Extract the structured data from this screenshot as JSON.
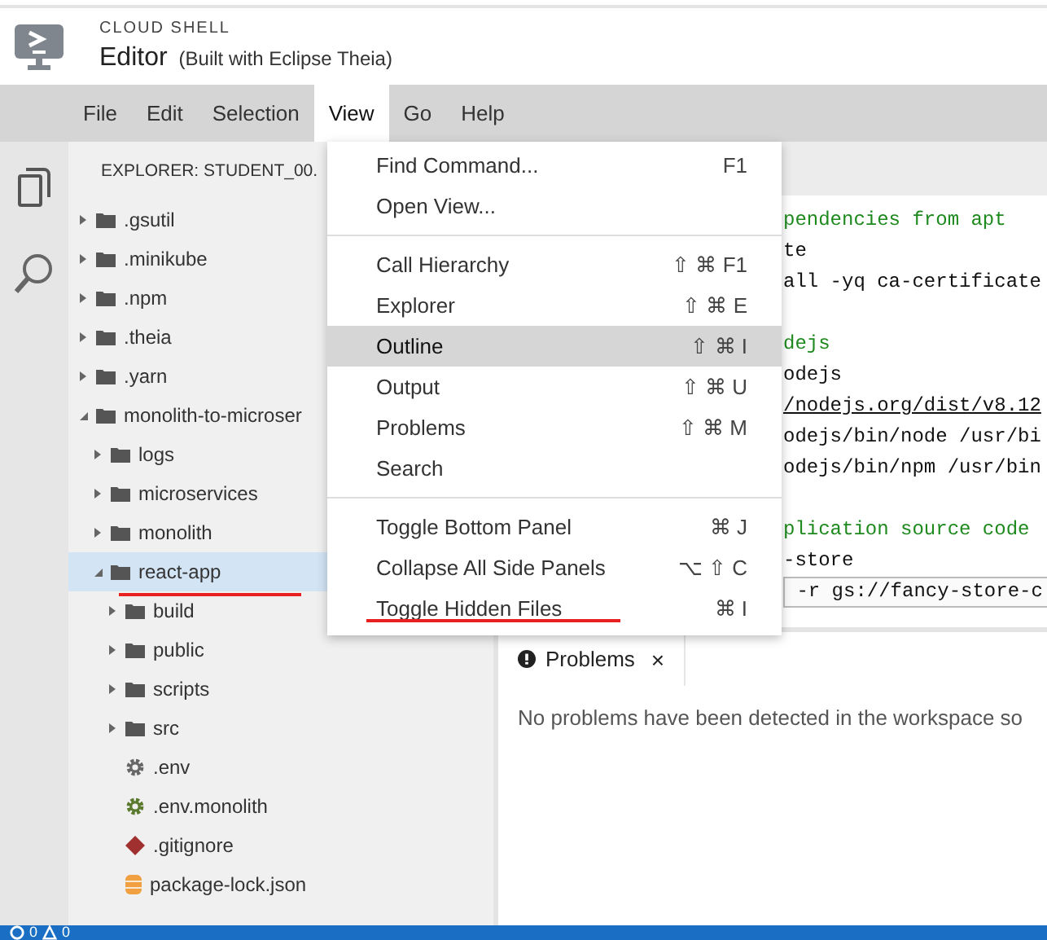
{
  "header": {
    "product": "CLOUD SHELL",
    "title": "Editor",
    "subtitle": "(Built with Eclipse Theia)"
  },
  "menubar": [
    {
      "label": "File",
      "selected": false
    },
    {
      "label": "Edit",
      "selected": false
    },
    {
      "label": "Selection",
      "selected": false
    },
    {
      "label": "View",
      "selected": true
    },
    {
      "label": "Go",
      "selected": false
    },
    {
      "label": "Help",
      "selected": false
    }
  ],
  "sidebar": {
    "title": "EXPLORER: STUDENT_00.",
    "tree": [
      {
        "label": ".gsutil",
        "kind": "folder",
        "expanded": false,
        "selected": false
      },
      {
        "label": ".minikube",
        "kind": "folder",
        "expanded": false,
        "selected": false
      },
      {
        "label": ".npm",
        "kind": "folder",
        "expanded": false,
        "selected": false
      },
      {
        "label": ".theia",
        "kind": "folder",
        "expanded": false,
        "selected": false
      },
      {
        "label": ".yarn",
        "kind": "folder",
        "expanded": false,
        "selected": false
      },
      {
        "label": "monolith-to-microser",
        "kind": "folder",
        "expanded": true,
        "selected": false,
        "children": [
          {
            "label": "logs",
            "kind": "folder",
            "expanded": false,
            "selected": false
          },
          {
            "label": "microservices",
            "kind": "folder",
            "expanded": false,
            "selected": false
          },
          {
            "label": "monolith",
            "kind": "folder",
            "expanded": false,
            "selected": false
          },
          {
            "label": "react-app",
            "kind": "folder",
            "expanded": true,
            "selected": true,
            "children": [
              {
                "label": "build",
                "kind": "folder",
                "expanded": false,
                "selected": false
              },
              {
                "label": "public",
                "kind": "folder",
                "expanded": false,
                "selected": false
              },
              {
                "label": "scripts",
                "kind": "folder",
                "expanded": false,
                "selected": false
              },
              {
                "label": "src",
                "kind": "folder",
                "expanded": false,
                "selected": false
              },
              {
                "label": ".env",
                "kind": "settings-file",
                "selected": false
              },
              {
                "label": ".env.monolith",
                "kind": "config-file",
                "selected": false
              },
              {
                "label": ".gitignore",
                "kind": "git-file",
                "selected": false
              },
              {
                "label": "package-lock.json",
                "kind": "lock-file",
                "selected": false
              }
            ]
          }
        ]
      }
    ]
  },
  "view_menu": [
    [
      {
        "label": "Find Command...",
        "shortcut": "F1",
        "selected": false
      },
      {
        "label": "Open View...",
        "selected": false
      }
    ],
    [
      {
        "label": "Call Hierarchy",
        "shortcut": "⇧ ⌘ F1",
        "selected": false
      },
      {
        "label": "Explorer",
        "shortcut": "⇧ ⌘ E",
        "selected": false
      },
      {
        "label": "Outline",
        "shortcut": "⇧ ⌘ I",
        "selected": true
      },
      {
        "label": "Output",
        "shortcut": "⇧ ⌘ U",
        "selected": false
      },
      {
        "label": "Problems",
        "shortcut": "⇧ ⌘ M",
        "selected": false
      },
      {
        "label": "Search",
        "selected": false
      }
    ],
    [
      {
        "label": "Toggle Bottom Panel",
        "shortcut": "⌘ J",
        "selected": false
      },
      {
        "label": "Collapse All Side Panels",
        "shortcut": "⌥ ⇧ C",
        "selected": false
      },
      {
        "label": "Toggle Hidden Files",
        "shortcut": "⌘ I",
        "selected": false
      }
    ]
  ],
  "editor": {
    "lines": [
      {
        "text": "pendencies from apt",
        "kind": "comment"
      },
      {
        "text": "te",
        "kind": "code"
      },
      {
        "text": "all -yq ca-certificate",
        "kind": "code"
      },
      {
        "kind": "blank"
      },
      {
        "text": "dejs",
        "kind": "comment"
      },
      {
        "text": "odejs",
        "kind": "code"
      },
      {
        "text": "/nodejs.org/dist/v8.12",
        "kind": "link"
      },
      {
        "text": "odejs/bin/node /usr/bi",
        "kind": "code"
      },
      {
        "text": "odejs/bin/npm /usr/bin",
        "kind": "code"
      },
      {
        "kind": "blank"
      },
      {
        "text": "plication source code",
        "kind": "comment"
      },
      {
        "text": "-store",
        "kind": "code"
      },
      {
        "text": " -r gs://fancy-store-c",
        "kind": "current-line"
      }
    ]
  },
  "panel": {
    "tab": "Problems",
    "close": "×",
    "message": "No problems have been detected in the workspace so"
  },
  "status_bar": {
    "errors": "0",
    "warnings": "0"
  }
}
